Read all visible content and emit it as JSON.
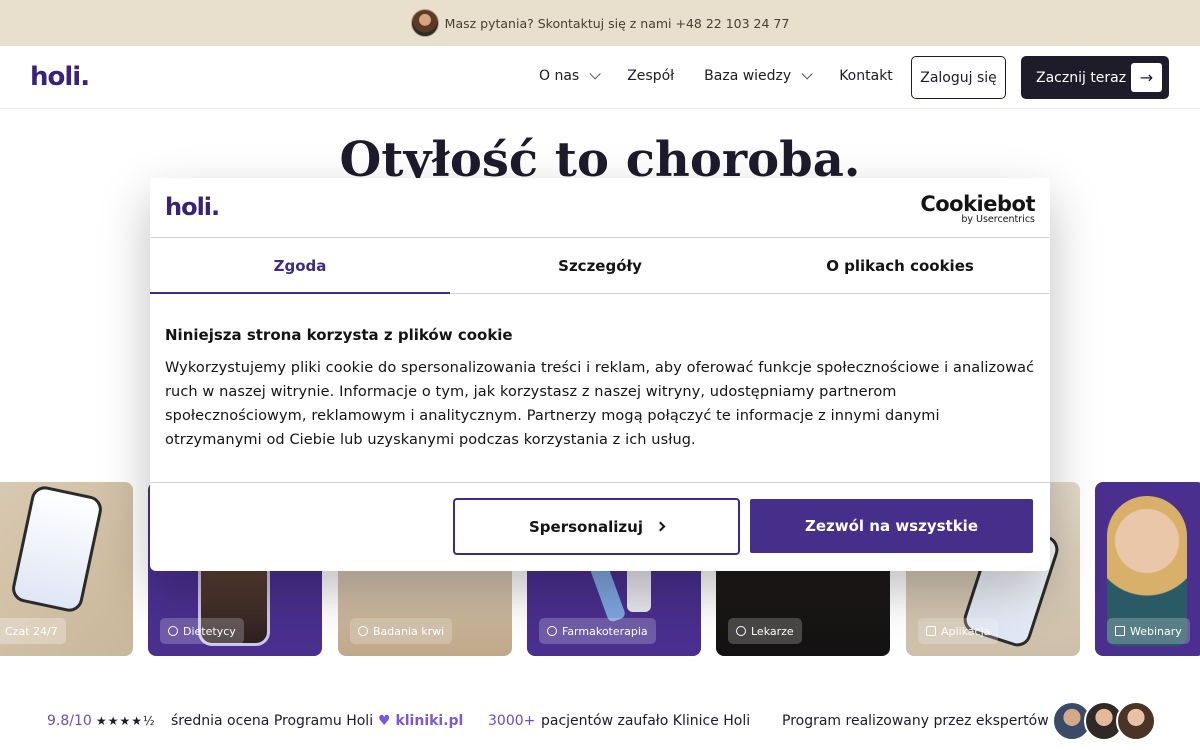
{
  "topbar": {
    "text": "Masz pytania? Skontaktuj się z nami +48 22 103 24 77"
  },
  "header": {
    "logo": "holi.",
    "nav": [
      {
        "label": "O nas",
        "has_dropdown": true
      },
      {
        "label": "Zespół",
        "has_dropdown": false
      },
      {
        "label": "Baza wiedzy",
        "has_dropdown": true
      },
      {
        "label": "Kontakt",
        "has_dropdown": false
      }
    ],
    "login_label": "Zaloguj się",
    "start_label": "Zacznij teraz"
  },
  "hero": {
    "title": "Otyłość to choroba."
  },
  "cards": [
    {
      "label": "Czat 24/7",
      "icon": "chat-icon"
    },
    {
      "label": "Dietetycy",
      "icon": "globe-icon"
    },
    {
      "label": "Badania krwi",
      "icon": "drop-icon"
    },
    {
      "label": "Farmakoterapia",
      "icon": "pills-icon"
    },
    {
      "label": "Lekarze",
      "icon": "plus-icon"
    },
    {
      "label": "Aplikacja",
      "icon": "phone-icon"
    },
    {
      "label": "Webinary",
      "icon": "book-icon"
    }
  ],
  "stats": {
    "rating": "9.8/10",
    "rating_stars": 4.5,
    "rating_text": "średnia ocena Programu Holi",
    "source": "kliniki.pl",
    "patients": "3000+",
    "patients_text": "pacjentów zaufało Klinice Holi",
    "experts_text": "Program realizowany przez ekspertów"
  },
  "cookie_dialog": {
    "logo": "holi.",
    "brand": "Cookiebot",
    "brand_sub": "by Usercentrics",
    "tabs": [
      {
        "label": "Zgoda",
        "active": true
      },
      {
        "label": "Szczegóły",
        "active": false
      },
      {
        "label": "O plikach cookies",
        "active": false
      }
    ],
    "heading": "Niniejsza strona korzysta z plików cookie",
    "body": "Wykorzystujemy pliki cookie do spersonalizowania treści i reklam, aby oferować funkcje społecznościowe i analizować ruch w naszej witrynie. Informacje o tym, jak korzystasz z naszej witryny, udostępniamy partnerom społecznościowym, reklamowym i analitycznym. Partnerzy mogą połączyć te informacje z innymi danymi otrzymanymi od Ciebie lub uzyskanymi podczas korzystania z ich usług.",
    "customize_label": "Spersonalizuj",
    "allow_label": "Zezwól na wszystkie"
  },
  "colors": {
    "brand_purple": "#3a2377",
    "accent_purple": "#452f8a",
    "banner_bg": "#e9dfcd",
    "dark_button": "#1e1c2a"
  }
}
